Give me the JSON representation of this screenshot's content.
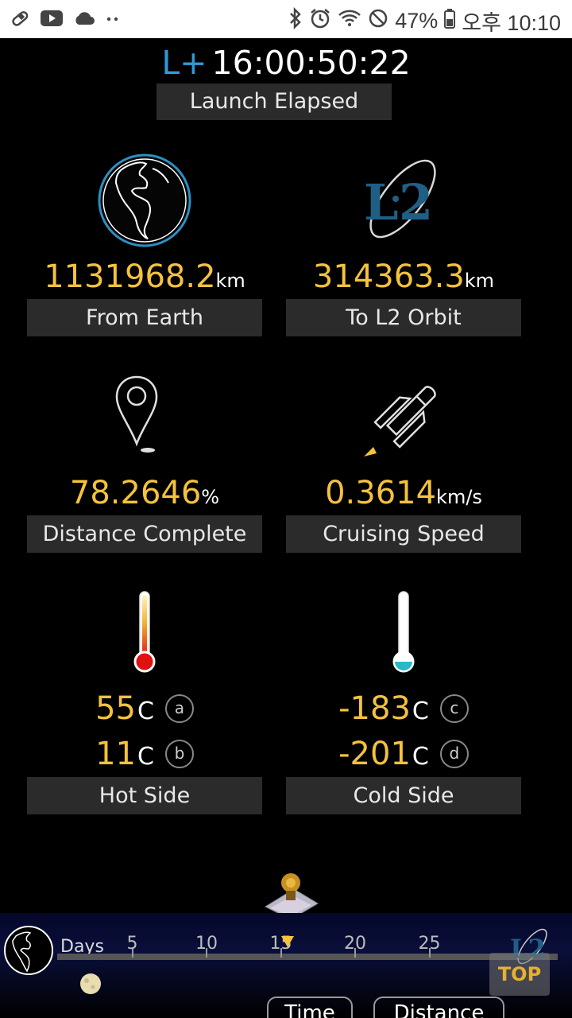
{
  "status_bar": {
    "battery": "47%",
    "time": "오후 10:10"
  },
  "elapsed": {
    "prefix": "L+",
    "value": "16:00:50:22",
    "label": "Launch Elapsed"
  },
  "stats": {
    "from_earth": {
      "value": "1131968.2",
      "unit": "km",
      "label": "From Earth"
    },
    "to_l2": {
      "value": "314363.3",
      "unit": "km",
      "label": "To L2 Orbit"
    },
    "distance": {
      "value": "78.2646",
      "unit": "%",
      "label": "Distance Complete"
    },
    "speed": {
      "value": "0.3614",
      "unit": "km/s",
      "label": "Cruising Speed"
    }
  },
  "hot_side": {
    "label": "Hot Side",
    "readings": [
      {
        "value": "55",
        "unit": "C",
        "badge": "a"
      },
      {
        "value": "11",
        "unit": "C",
        "badge": "b"
      }
    ]
  },
  "cold_side": {
    "label": "Cold Side",
    "readings": [
      {
        "value": "-183",
        "unit": "C",
        "badge": "c"
      },
      {
        "value": "-201",
        "unit": "C",
        "badge": "d"
      }
    ]
  },
  "timeline": {
    "days_label": "Days",
    "ticks": [
      "5",
      "10",
      "15",
      "20",
      "25"
    ],
    "current_day": 15.5,
    "top_button": "TOP",
    "bottom_buttons": [
      "Time",
      "Distance"
    ]
  },
  "colors": {
    "accent_value": "#f5c23c",
    "lplus": "#2f9ad8",
    "label_bg": "#2b2b2b"
  }
}
